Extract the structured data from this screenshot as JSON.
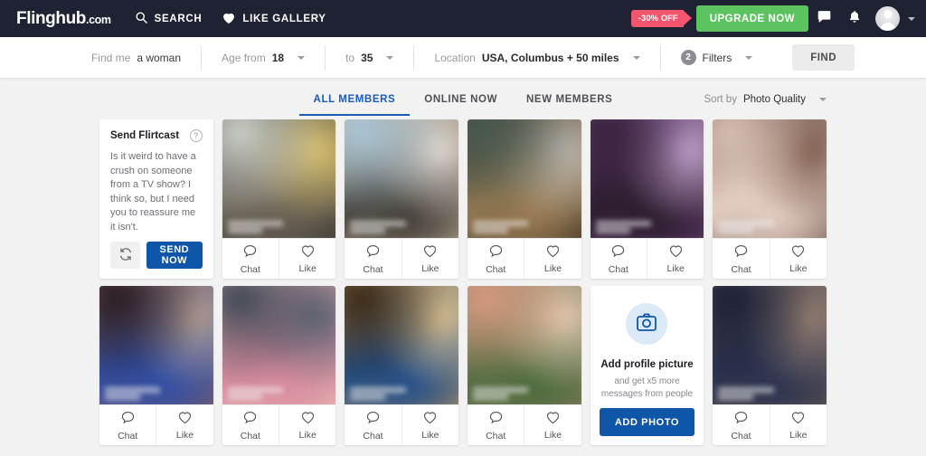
{
  "header": {
    "logo_main": "Flinghub",
    "logo_suffix": ".com",
    "nav": [
      {
        "label": "SEARCH",
        "icon": "search-icon"
      },
      {
        "label": "LIKE GALLERY",
        "icon": "heart-icon"
      }
    ],
    "discount_badge": "-30% OFF",
    "upgrade_label": "UPGRADE NOW",
    "icons": [
      "chat-bubble-icon",
      "bell-icon",
      "avatar",
      "chevron-down-icon"
    ],
    "colors": {
      "bar_bg": "#1e2233",
      "upgrade_green": "#5dc260",
      "badge_red": "#f2556d"
    }
  },
  "search": {
    "find_me_label": "Find me",
    "find_me_value": "a woman",
    "age_from_label": "Age from",
    "age_from_value": "18",
    "age_to_label": "to",
    "age_to_value": "35",
    "location_label": "Location",
    "location_value": "USA, Columbus + 50 miles",
    "filters_count": "2",
    "filters_label": "Filters",
    "find_button": "FIND"
  },
  "tabs": [
    {
      "label": "ALL MEMBERS",
      "active": true
    },
    {
      "label": "ONLINE NOW",
      "active": false
    },
    {
      "label": "NEW MEMBERS",
      "active": false
    }
  ],
  "sort": {
    "label": "Sort by",
    "value": "Photo Quality"
  },
  "flirtcast": {
    "title": "Send Flirtcast",
    "help_icon": "question-mark-icon",
    "message": "Is it weird to have a crush on someone from a TV show? I think so, but I need you to reassure me it isn't.",
    "refresh_icon": "refresh-icon",
    "send_label": "SEND NOW"
  },
  "add_photo_card": {
    "icon": "camera-icon",
    "title": "Add profile picture",
    "subtitle": "and get x5 more messages from people",
    "button_label": "ADD PHOTO"
  },
  "card_actions": {
    "chat_label": "Chat",
    "chat_icon": "chat-bubble-icon",
    "like_label": "Like",
    "like_icon": "heart-outline-icon"
  },
  "grid": {
    "rows": [
      {
        "cells": [
          {
            "type": "flirtcast"
          },
          {
            "type": "photo",
            "c1": "#cfd3cc",
            "c2": "#2b2a26",
            "c3": "#6a6255",
            "c4": "#d8c06a"
          },
          {
            "type": "photo",
            "c1": "#a9c6d6",
            "c2": "#c9b6a4",
            "c3": "#3e3a33",
            "c4": "#e6dcd2"
          },
          {
            "type": "photo",
            "c1": "#4a5d52",
            "c2": "#241f1c",
            "c3": "#9c7c52",
            "c4": "#b8b4ad"
          },
          {
            "type": "photo",
            "c1": "#3a2340",
            "c2": "#6b3f7a",
            "c3": "#2a1b2c",
            "c4": "#c9a6d4"
          },
          {
            "type": "photo",
            "c1": "#d9c0b4",
            "c2": "#5a4038",
            "c3": "#e8d2c6",
            "c4": "#7a5a4c"
          }
        ]
      },
      {
        "cells": [
          {
            "type": "photo",
            "c1": "#2a1d22",
            "c2": "#8a5f58",
            "c3": "#2e4ea8",
            "c4": "#b8a090"
          },
          {
            "type": "photo",
            "c1": "#3c4654",
            "c2": "#e8c0b4",
            "c3": "#d88a9e",
            "c4": "#5a6472"
          },
          {
            "type": "photo",
            "c1": "#3a2a18",
            "c2": "#c89a56",
            "c3": "#1d4c8a",
            "c4": "#e0c490"
          },
          {
            "type": "photo",
            "c1": "#d89a82",
            "c2": "#8a7a5c",
            "c3": "#4a6a3c",
            "c4": "#e8cbb4"
          },
          {
            "type": "addphoto"
          },
          {
            "type": "photo",
            "c1": "#1a2038",
            "c2": "#6a5a50",
            "c3": "#2a3250",
            "c4": "#9a8272"
          }
        ]
      }
    ]
  }
}
